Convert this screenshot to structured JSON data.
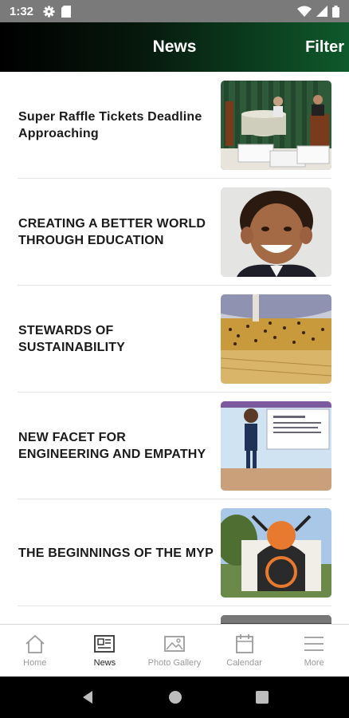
{
  "status_bar": {
    "time": "1:32",
    "icons": [
      "gear-icon",
      "sim-card-icon",
      "wifi-icon",
      "signal-icon",
      "battery-icon"
    ]
  },
  "header": {
    "title": "News",
    "filter_label": "Filter"
  },
  "colors": {
    "header_gradient_start": "#000000",
    "header_gradient_end": "#0f5a2c",
    "status_bar": "#7a7a7a",
    "active_tab": "#222222",
    "inactive_tab": "#9a9a9a"
  },
  "news": [
    {
      "title": "Super Raffle Tickets Deadline Approaching"
    },
    {
      "title": "CREATING A BETTER WORLD THROUGH EDUCATION"
    },
    {
      "title": "STEWARDS OF SUSTAINABILITY"
    },
    {
      "title": "NEW FACET FOR ENGINEERING AND EMPATHY"
    },
    {
      "title": "THE BEGINNINGS OF THE MYP"
    }
  ],
  "tabs": [
    {
      "label": "Home",
      "icon": "home-icon",
      "active": false
    },
    {
      "label": "News",
      "icon": "newspaper-icon",
      "active": true
    },
    {
      "label": "Photo Gallery",
      "icon": "image-icon",
      "active": false
    },
    {
      "label": "Calendar",
      "icon": "calendar-icon",
      "active": false
    },
    {
      "label": "More",
      "icon": "menu-icon",
      "active": false
    }
  ],
  "system_nav": [
    "back-icon",
    "home-circle-icon",
    "recents-icon"
  ]
}
